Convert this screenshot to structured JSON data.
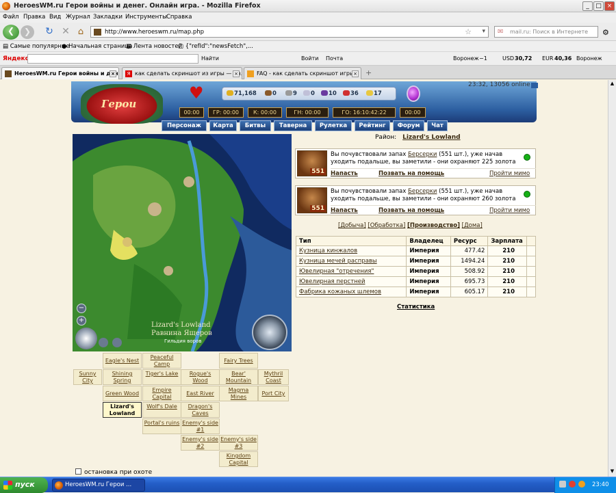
{
  "window": {
    "title": "HeroesWM.ru Герои войны и денег. Онлайн игра. - Mozilla Firefox",
    "min": "_",
    "max": "□",
    "close": "×"
  },
  "menu": [
    "Файл",
    "Правка",
    "Вид",
    "Журнал",
    "Закладки",
    "Инструменты",
    "Справка"
  ],
  "navbar": {
    "url": "http://www.heroeswm.ru/map.php",
    "search_placeholder": "mail.ru: Поиск в Интернете"
  },
  "bookmarks": [
    "Самые популярные",
    "Начальная страница",
    "Лента новостей",
    "{\"refId\":\"newsFetch\",..."
  ],
  "yandex": {
    "logo": "Яндекс",
    "find": "Найти",
    "login": "Войти",
    "mail": "Почта",
    "city": "Воронеж",
    "usd_label": "USD",
    "usd": "30,72",
    "eur_label": "EUR",
    "eur": "40,36",
    "city2": "Воронеж",
    "temp": "−1"
  },
  "tabs": [
    {
      "label": "HeroesWM.ru Герои войны и ден...",
      "active": true
    },
    {
      "label": "как сделать скриншот из игры — Ян...",
      "active": false
    },
    {
      "label": "FAQ - как сделать скриншот игры",
      "active": false
    }
  ],
  "game": {
    "logo_text": "Герои",
    "resources": [
      "71,168",
      "0",
      "9",
      "0",
      "10",
      "36",
      "17"
    ],
    "resource_colors": [
      "#e0b020",
      "#8a5a2a",
      "#9a9a9a",
      "#c0c0d8",
      "#6a3aa0",
      "#d03030",
      "#e8c840"
    ],
    "online": "23:32, 13056 online",
    "timers": [
      "00:00",
      "ГР: 00:00",
      "К: 00:00",
      "ГН: 00:00",
      "ГО: 16:10:42:22",
      "00:00"
    ],
    "nav": [
      "Персонаж",
      "Карта",
      "Битвы",
      "Таверна",
      "Рулетка",
      "Рейтинг",
      "Форум",
      "Чат"
    ]
  },
  "map": {
    "name_en": "Lizard's Lowland",
    "name_ru": "Равнина Ящеров",
    "guild": "Гильдия воров",
    "zoom_out": "−",
    "zoom_in": "+"
  },
  "locations": [
    {
      "label": "Eagle's Nest"
    },
    {
      "label": "Peaceful Camp"
    },
    {
      "label": "Fairy Trees"
    },
    {
      "label": "Sunny City"
    },
    {
      "label": "Shining Spring"
    },
    {
      "label": "Tiger's Lake"
    },
    {
      "label": "Rogue's Wood"
    },
    {
      "label": "Bear' Mountain"
    },
    {
      "label": "Mythril Coast"
    },
    {
      "label": "Green Wood"
    },
    {
      "label": "Empire Capital"
    },
    {
      "label": "East River"
    },
    {
      "label": "Magma Mines"
    },
    {
      "label": "Port City"
    },
    {
      "label": "Lizard's Lowland"
    },
    {
      "label": "Wolf's Dale"
    },
    {
      "label": "Dragon's Caves"
    },
    {
      "label": "Portal's ruins"
    },
    {
      "label": "Enemy's side #1"
    },
    {
      "label": "Enemy's side #2"
    },
    {
      "label": "Enemy's side #3"
    },
    {
      "label": "Kingdom Capital"
    }
  ],
  "district": {
    "label": "Район:",
    "name": "Lizard's Lowland"
  },
  "mobs": [
    {
      "count": "551",
      "text_a": "Вы почувствовали запах ",
      "creature": "Берсерки",
      "text_b": " (551 шт.), уже начав уходить подальше, вы заметили - они охраняют 225 золота",
      "attack": "Напасть",
      "help": "Позвать на помощь",
      "pass": "Пройти мимо"
    },
    {
      "count": "551",
      "text_a": "Вы почувствовали запах ",
      "creature": "Берсерки",
      "text_b": " (551 шт.), уже начав уходить подальше, вы заметили - они охраняют 260 золота",
      "attack": "Напасть",
      "help": "Позвать на помощь",
      "pass": "Пройти мимо"
    }
  ],
  "object_tabs": [
    "[Добыча]",
    "[Обработка]",
    "[Производство]",
    "[Дома]"
  ],
  "table": {
    "headers": [
      "Тип",
      "Владелец",
      "Ресурс",
      "Зарплата"
    ],
    "rows": [
      [
        "Кузница кинжалов",
        "Империя",
        "477.42",
        "210"
      ],
      [
        "Кузница мечей расправы",
        "Империя",
        "1494.24",
        "210"
      ],
      [
        "Ювелирная \"отречения\"",
        "Империя",
        "508.92",
        "210"
      ],
      [
        "Ювелирная перстней",
        "Империя",
        "695.73",
        "210"
      ],
      [
        "Фабрика кожаных шлемов",
        "Империя",
        "605.17",
        "210"
      ]
    ]
  },
  "statistics": "Статистика",
  "hunt_stop": "остановка при охоте",
  "taskbar": {
    "start": "пуск",
    "item": "HeroesWM.ru Герои ...",
    "time": "23:40"
  }
}
